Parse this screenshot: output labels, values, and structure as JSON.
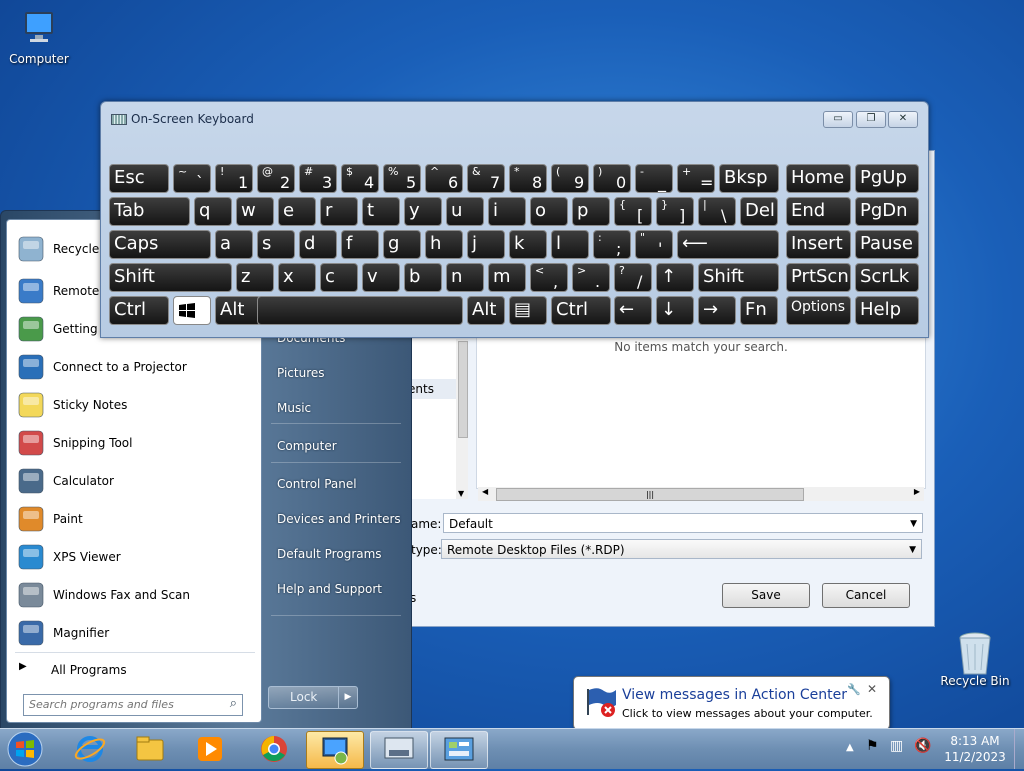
{
  "desktop": {
    "icons": [
      {
        "label": "Computer",
        "icon": "computer-icon"
      },
      {
        "label": "Recycle Bin",
        "icon": "recycle-bin-icon"
      }
    ]
  },
  "osk": {
    "title": "On-Screen Keyboard",
    "controls": {
      "minimize": "▭",
      "restore": "❐",
      "close": "✕"
    },
    "keys": [
      {
        "n": "Esc",
        "m": "Esc"
      },
      {
        "n": "tilde",
        "h": "~",
        "l": "`"
      },
      {
        "n": "1",
        "h": "!",
        "l": "1"
      },
      {
        "n": "2",
        "h": "@",
        "l": "2"
      },
      {
        "n": "3",
        "h": "#",
        "l": "3"
      },
      {
        "n": "4",
        "h": "$",
        "l": "4"
      },
      {
        "n": "5",
        "h": "%",
        "l": "5"
      },
      {
        "n": "6",
        "h": "^",
        "l": "6"
      },
      {
        "n": "7",
        "h": "&",
        "l": "7"
      },
      {
        "n": "8",
        "h": "*",
        "l": "8"
      },
      {
        "n": "9",
        "h": "(",
        "l": "9"
      },
      {
        "n": "0",
        "h": ")",
        "l": "0"
      },
      {
        "n": "minus",
        "h": "-",
        "l": "_"
      },
      {
        "n": "equals",
        "h": "+",
        "l": "="
      },
      {
        "n": "bksp",
        "m": "Bksp"
      },
      {
        "n": "home",
        "m": "Home"
      },
      {
        "n": "pgup",
        "m": "PgUp"
      },
      {
        "n": "tab",
        "m": "Tab"
      },
      {
        "n": "q",
        "m": "q"
      },
      {
        "n": "w",
        "m": "w"
      },
      {
        "n": "e",
        "m": "e"
      },
      {
        "n": "r",
        "m": "r"
      },
      {
        "n": "t",
        "m": "t"
      },
      {
        "n": "y",
        "m": "y"
      },
      {
        "n": "u",
        "m": "u"
      },
      {
        "n": "i",
        "m": "i"
      },
      {
        "n": "o",
        "m": "o"
      },
      {
        "n": "p",
        "m": "p"
      },
      {
        "n": "lbracket",
        "h": "{",
        "l": "["
      },
      {
        "n": "rbracket",
        "h": "}",
        "l": "]"
      },
      {
        "n": "backslash",
        "h": "|",
        "l": "\\"
      },
      {
        "n": "del",
        "m": "Del"
      },
      {
        "n": "end",
        "m": "End"
      },
      {
        "n": "pgdn",
        "m": "PgDn"
      },
      {
        "n": "caps",
        "m": "Caps"
      },
      {
        "n": "a",
        "m": "a"
      },
      {
        "n": "s",
        "m": "s"
      },
      {
        "n": "d",
        "m": "d"
      },
      {
        "n": "f",
        "m": "f"
      },
      {
        "n": "g",
        "m": "g"
      },
      {
        "n": "h",
        "m": "h"
      },
      {
        "n": "j",
        "m": "j"
      },
      {
        "n": "k",
        "m": "k"
      },
      {
        "n": "l",
        "m": "l"
      },
      {
        "n": "semicolon",
        "h": ":",
        "l": ";"
      },
      {
        "n": "quote",
        "h": "\"",
        "l": "'"
      },
      {
        "n": "enter",
        "m": "⟵"
      },
      {
        "n": "insert",
        "m": "Insert"
      },
      {
        "n": "pause",
        "m": "Pause"
      },
      {
        "n": "lshift",
        "m": "Shift"
      },
      {
        "n": "z",
        "m": "z"
      },
      {
        "n": "x",
        "m": "x"
      },
      {
        "n": "c",
        "m": "c"
      },
      {
        "n": "v",
        "m": "v"
      },
      {
        "n": "b",
        "m": "b"
      },
      {
        "n": "n",
        "m": "n"
      },
      {
        "n": "m",
        "m": "m"
      },
      {
        "n": "comma",
        "h": "<",
        "l": ","
      },
      {
        "n": "period",
        "h": ">",
        "l": "."
      },
      {
        "n": "slash",
        "h": "?",
        "l": "/"
      },
      {
        "n": "up",
        "m": "↑"
      },
      {
        "n": "rshift",
        "m": "Shift"
      },
      {
        "n": "prtscn",
        "m": "PrtScn"
      },
      {
        "n": "scrlk",
        "m": "ScrLk"
      },
      {
        "n": "lctrl",
        "m": "Ctrl"
      },
      {
        "n": "win",
        "m": ""
      },
      {
        "n": "lalt",
        "m": "Alt"
      },
      {
        "n": "space",
        "m": ""
      },
      {
        "n": "ralt",
        "m": "Alt"
      },
      {
        "n": "menu",
        "m": "▤"
      },
      {
        "n": "rctrl",
        "m": "Ctrl"
      },
      {
        "n": "left",
        "m": "←"
      },
      {
        "n": "down",
        "m": "↓"
      },
      {
        "n": "right",
        "m": "→"
      },
      {
        "n": "fn",
        "m": "Fn"
      },
      {
        "n": "options",
        "m": "Options"
      },
      {
        "n": "help",
        "m": "Help"
      }
    ]
  },
  "save_dialog": {
    "empty_message": "No items match your search.",
    "nav_partial": "ents",
    "file_name_label": "ame:",
    "file_name_value": "Default",
    "save_type_label": "type:",
    "save_type_value": "Remote Desktop Files (*.RDP)",
    "hide_folders_partial": "s",
    "save_label": "Save",
    "cancel_label": "Cancel"
  },
  "start_menu": {
    "pinned": [
      {
        "label": "Recycle B",
        "icon": "recycle-bin-icon"
      },
      {
        "label": "Remote D",
        "icon": "remote-desktop-icon"
      },
      {
        "label": "Getting S",
        "icon": "getting-started-icon"
      },
      {
        "label": "Connect to a Projector",
        "icon": "projector-icon"
      },
      {
        "label": "Sticky Notes",
        "icon": "sticky-notes-icon"
      },
      {
        "label": "Snipping Tool",
        "icon": "snipping-tool-icon"
      },
      {
        "label": "Calculator",
        "icon": "calculator-icon"
      },
      {
        "label": "Paint",
        "icon": "paint-icon"
      },
      {
        "label": "XPS Viewer",
        "icon": "xps-viewer-icon"
      },
      {
        "label": "Windows Fax and Scan",
        "icon": "fax-scan-icon"
      },
      {
        "label": "Magnifier",
        "icon": "magnifier-icon"
      }
    ],
    "all_programs": "All Programs",
    "search_placeholder": "Search programs and files",
    "right_items": [
      "Documents",
      "Pictures",
      "Music",
      "Computer",
      "Control Panel",
      "Devices and Printers",
      "Default Programs",
      "Help and Support"
    ],
    "lock_label": "Lock"
  },
  "notification": {
    "title": "View messages in Action Center",
    "body": "Click to view messages about your computer."
  },
  "taskbar": {
    "apps": [
      "internet-explorer-icon",
      "windows-explorer-icon",
      "media-player-icon",
      "chrome-icon",
      "remote-desktop-icon",
      "on-screen-keyboard-icon",
      "control-panel-icon"
    ],
    "time": "8:13 AM",
    "date": "11/2/2023"
  }
}
